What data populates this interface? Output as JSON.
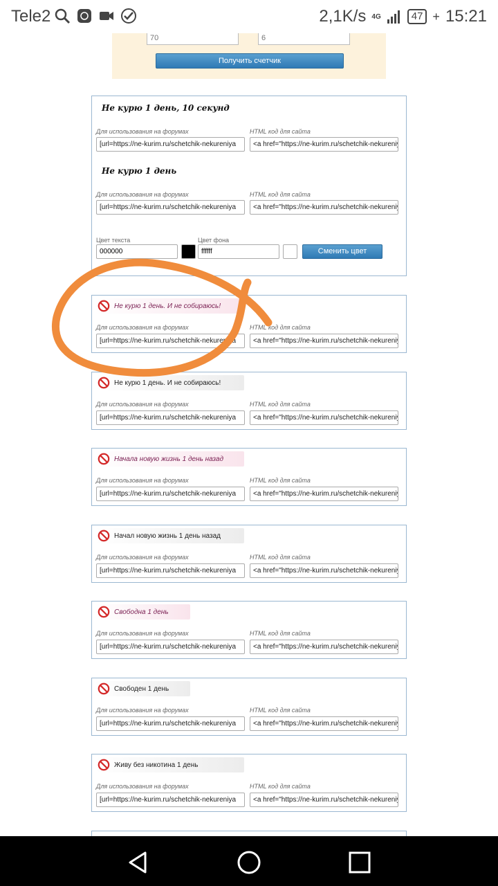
{
  "status_bar": {
    "carrier": "Tele2",
    "speed": "2,1K/s",
    "network": "4G",
    "battery": "47",
    "time": "15:21"
  },
  "top_panel": {
    "input_left": "70",
    "input_right": "6",
    "button": "Получить счетчик"
  },
  "labels": {
    "forum": "Для использования на форумах",
    "html": "HTML код для сайта"
  },
  "codes": {
    "bbcode": "[url=https://ne-kurim.ru/schetchik-nekureniya",
    "html": "<a href=\"https://ne-kurim.ru/schetchik-nekureniya"
  },
  "text_counter": {
    "line1": "Не курю 1 день, 10 секунд",
    "line2": "Не курю 1 день",
    "text_color_label": "Цвет текста",
    "text_color_value": "000000",
    "bg_color_label": "Цвет фона",
    "bg_color_value": "ffffff",
    "change_button": "Сменить цвет",
    "colors": {
      "text": "#000000",
      "background": "#ffffff"
    }
  },
  "counters": [
    {
      "text": "Не курю 1 день. И не собираюсь!",
      "style": "pink"
    },
    {
      "text": "Не курю 1 день. И не собираюсь!",
      "style": "gray"
    },
    {
      "text": "Начала новую жизнь 1 день назад",
      "style": "pink"
    },
    {
      "text": "Начал новую жизнь 1 день назад",
      "style": "gray"
    },
    {
      "text": "Свободна 1 день",
      "style": "pink"
    },
    {
      "text": "Свободен 1 день",
      "style": "gray"
    },
    {
      "text": "Живу без никотина 1 день",
      "style": "gray"
    }
  ],
  "colors": {
    "annotation": "#f08c3c",
    "button": "#3a86c0",
    "card_border": "#9ab7d1"
  },
  "icons": [
    "search-icon",
    "camera-icon",
    "sberbank-icon",
    "no-smoking-icon",
    "back-icon",
    "home-icon",
    "recents-icon"
  ]
}
